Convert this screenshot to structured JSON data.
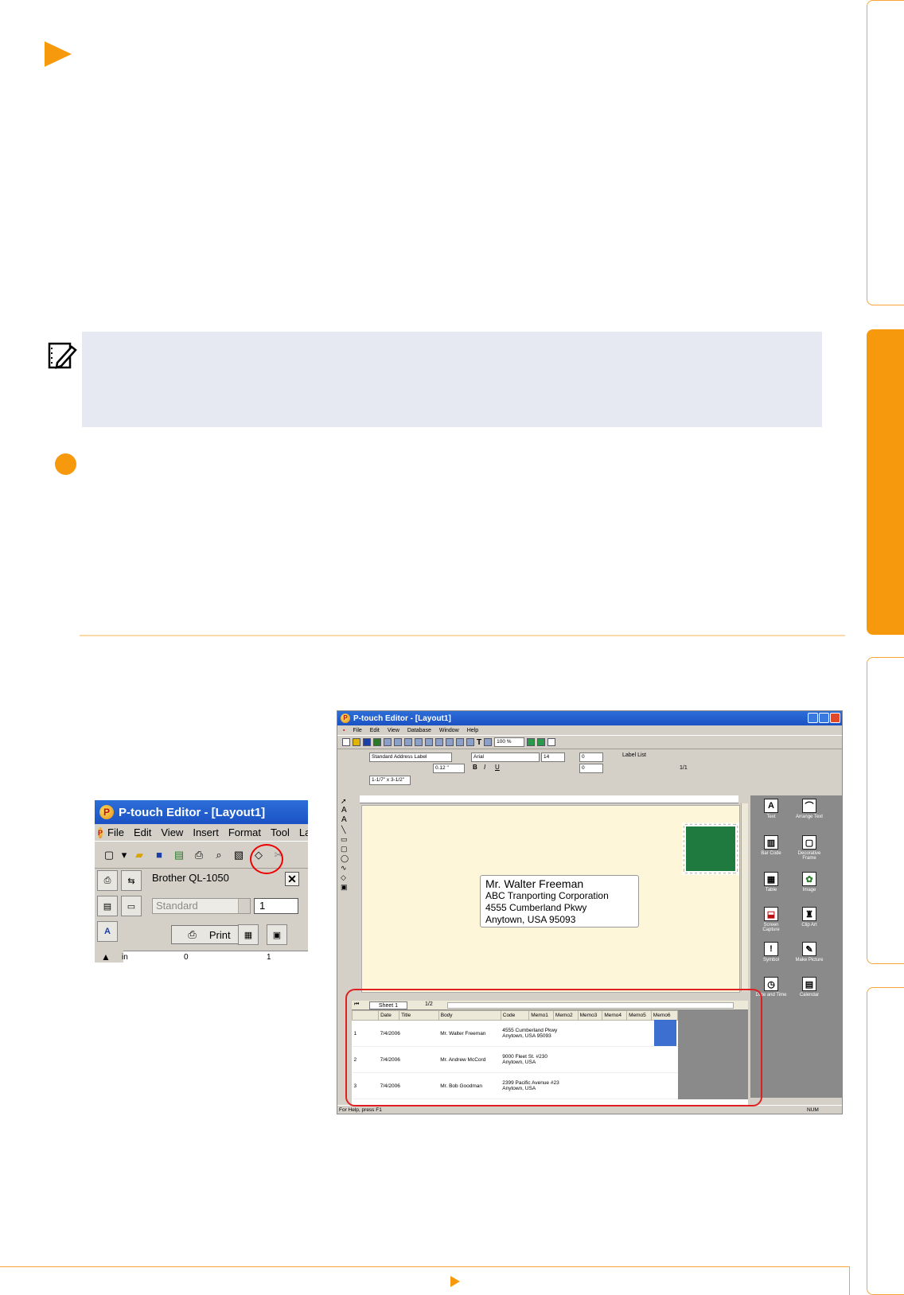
{
  "small_screenshot": {
    "title": "P-touch Editor - [Layout1]",
    "menu": [
      "File",
      "Edit",
      "View",
      "Insert",
      "Format",
      "Tool",
      "Lay"
    ],
    "printer_name": "Brother QL-1050",
    "quality_value": "Standard",
    "copies_value": "1",
    "print_label": "Print",
    "ruler_unit": "in",
    "ruler_marks": [
      "0",
      "1"
    ]
  },
  "large_screenshot": {
    "title": "P-touch Editor - [Layout1]",
    "menu": [
      "File",
      "Edit",
      "View",
      "Database",
      "Window",
      "Help"
    ],
    "zoom": "100 %",
    "label_type": "Standard Address Label",
    "length": "0.12 \"",
    "media_size": "1-1/7\" x 3-1/2\"",
    "font_name": "Arial",
    "font_size": "14",
    "spacing1": "0",
    "spacing2": "0",
    "label_list_title": "Label List",
    "label_list_page": "1/1",
    "address": {
      "name": "Mr. Walter Freeman",
      "company": "ABC Tranporting Corporation",
      "street": "4555 Cumberland Pkwy",
      "city": "Anytown, USA 95093"
    },
    "objects": [
      "Text",
      "Arrange Text",
      "Bar Code",
      "Decorative Frame",
      "Table",
      "Image",
      "Screen Capture",
      "Clip Art",
      "Symbol",
      "Make Picture",
      "Date and Time",
      "Calendar"
    ],
    "sheet_name": "Sheet 1",
    "sheet_page": "1/2",
    "columns": [
      "",
      "Date",
      "Title",
      "Body",
      "Code",
      "Memo1",
      "Memo2",
      "Memo3",
      "Memo4",
      "Memo5",
      "Memo6"
    ],
    "rows": [
      {
        "num": "1",
        "date": "7/4/2006",
        "title": "Mr. Walter Freeman",
        "body1": "4555 Cumberland Pkwy",
        "body2": "Anytown, USA 95093"
      },
      {
        "num": "2",
        "date": "7/4/2006",
        "title": "Mr. Andrew McCord",
        "body1": "9000 Fleet St. #230",
        "body2": "Anytown, USA"
      },
      {
        "num": "3",
        "date": "7/4/2006",
        "title": "Mr. Bob Goodman",
        "body1": "2399 Pacific Avenue #23",
        "body2": "Anytown, USA"
      }
    ],
    "status_text": "For Help, press F1",
    "status_num": "NUM"
  },
  "colors": {
    "accent_orange": "#f7990c",
    "note_bg": "#e6e8f2",
    "stamp_green": "#1e7a3e",
    "highlight_red": "#e02020"
  }
}
